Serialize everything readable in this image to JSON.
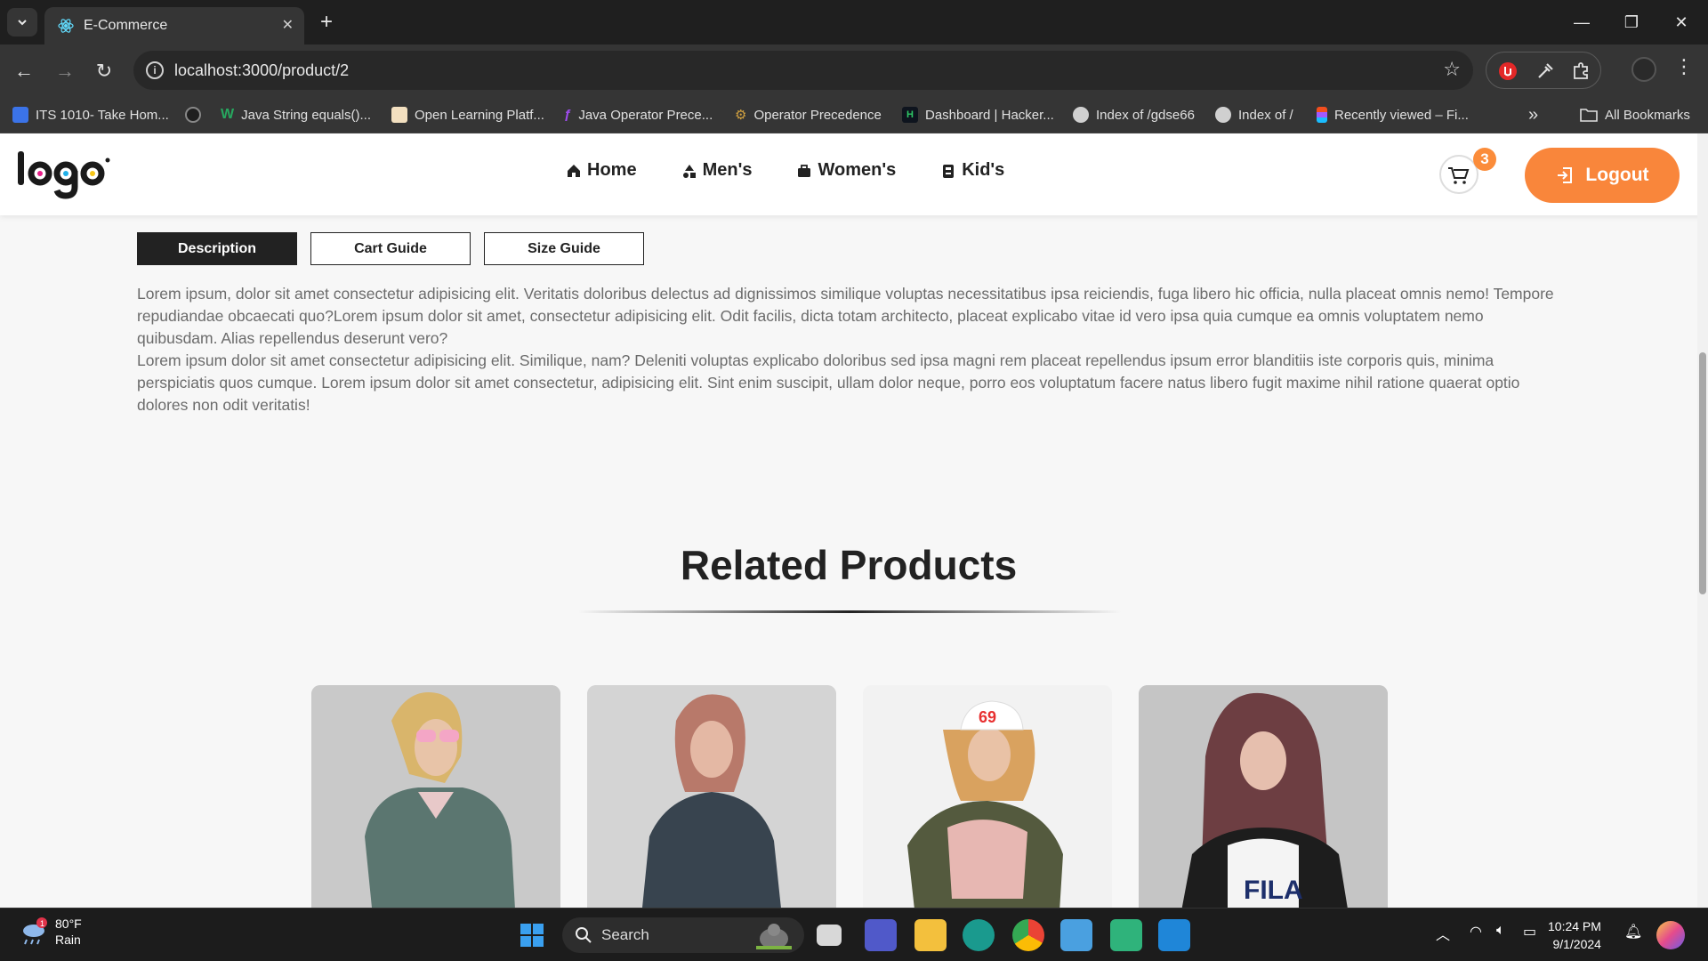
{
  "browser": {
    "tab_title": "E-Commerce",
    "url": "localhost:3000/product/2",
    "bookmarks": [
      "ITS 1010- Take Hom...",
      "",
      "Java String equals()...",
      "Open Learning Platf...",
      "Java Operator Prece...",
      "Operator Precedence",
      "Dashboard | Hacker...",
      "Index of /gdse66",
      "Index of /",
      "Recently viewed – Fi..."
    ],
    "all_bookmarks": "All Bookmarks",
    "overflow": "»"
  },
  "site": {
    "logo": "logo",
    "nav": [
      "Home",
      "Men's",
      "Women's",
      "Kid's"
    ],
    "cart_count": "3",
    "logout_label": "Logout",
    "accent_color": "#f9863b"
  },
  "product_tabs": [
    "Description",
    "Cart Guide",
    "Size Guide"
  ],
  "description": {
    "p1": "Lorem ipsum, dolor sit amet consectetur adipisicing elit. Veritatis doloribus delectus ad dignissimos similique voluptas necessitatibus ipsa reiciendis, fuga libero hic officia, nulla placeat omnis nemo! Tempore repudiandae obcaecati quo?Lorem ipsum dolor sit amet, consectetur adipisicing elit. Odit facilis, dicta totam architecto, placeat explicabo vitae id vero ipsa quia cumque ea omnis voluptatem nemo quibusdam. Alias repellendus deserunt vero?",
    "p2": "Lorem ipsum dolor sit amet consectetur adipisicing elit. Similique, nam? Deleniti voluptas explicabo doloribus sed ipsa magni rem placeat repellendus ipsum error blanditiis iste corporis quis, minima perspiciatis quos cumque. Lorem ipsum dolor sit amet consectetur, adipisicing elit. Sint enim suscipit, ullam dolor neque, porro eos voluptatum facere natus libero fugit maxime nihil ratione quaerat optio dolores non odit veritatis!"
  },
  "related": {
    "title": "Related Products",
    "cards": [
      {
        "image": "woman-green-puffer-jacket-pink-sunglasses"
      },
      {
        "image": "woman-dark-tshirt-copper-hair"
      },
      {
        "image": "woman-white-cap-pink-sweater"
      },
      {
        "image": "girl-long-wavy-hair-white-tshirt"
      }
    ]
  },
  "taskbar": {
    "weather_temp": "80°F",
    "weather_cond": "Rain",
    "weather_badge": "1",
    "search_label": "Search",
    "time": "10:24 PM",
    "date": "9/1/2024"
  }
}
